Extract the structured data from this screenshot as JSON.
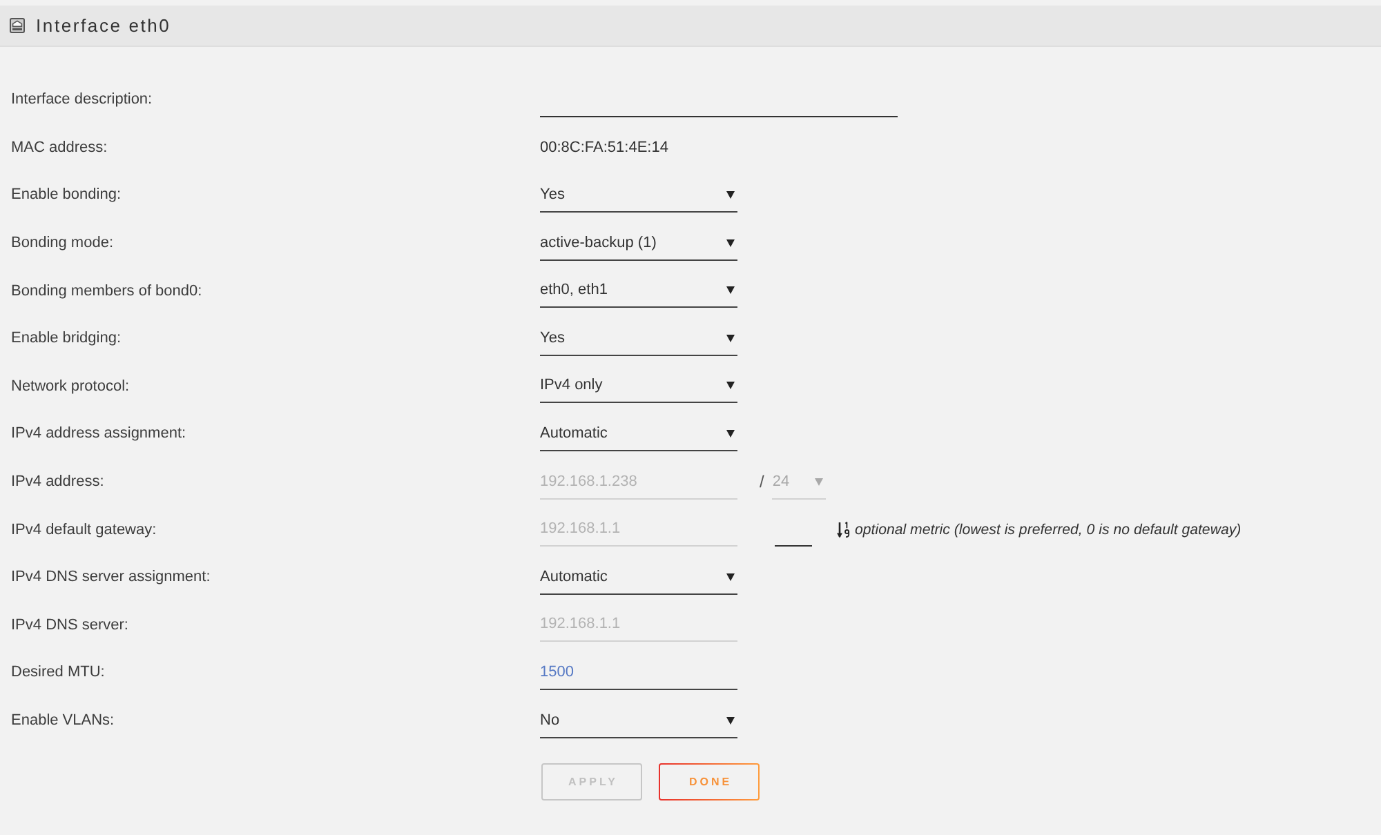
{
  "header": {
    "title": "Interface eth0"
  },
  "rows": [
    {
      "kind": "wide_input",
      "label": "Interface description:"
    },
    {
      "kind": "readout",
      "label": "MAC address:",
      "value": "00:8C:FA:51:4E:14"
    },
    {
      "kind": "select",
      "label": "Enable bonding:",
      "value": "Yes",
      "disabled": false
    },
    {
      "kind": "select",
      "label": "Bonding mode:",
      "value": "active-backup (1)",
      "disabled": false
    },
    {
      "kind": "select",
      "label": "Bonding members of bond0:",
      "value": "eth0, eth1",
      "disabled": false
    },
    {
      "kind": "select",
      "label": "Enable bridging:",
      "value": "Yes",
      "disabled": false
    },
    {
      "kind": "select",
      "label": "Network protocol:",
      "value": "IPv4 only",
      "disabled": false
    },
    {
      "kind": "select",
      "label": "IPv4 address assignment:",
      "value": "Automatic",
      "disabled": false
    },
    {
      "kind": "address",
      "label": "IPv4 address:",
      "value": "192.168.1.238",
      "disabled": true,
      "separator": "/",
      "prefix": {
        "value": "24",
        "disabled": true
      }
    },
    {
      "kind": "gateway",
      "label": "IPv4 default gateway:",
      "value": "192.168.1.1",
      "disabled": true,
      "metric_hint": "optional metric (lowest is preferred, 0 is no default gateway)"
    },
    {
      "kind": "select",
      "label": "IPv4 DNS server assignment:",
      "value": "Automatic",
      "disabled": false
    },
    {
      "kind": "input",
      "label": "IPv4 DNS server:",
      "value": "192.168.1.1",
      "disabled": true
    },
    {
      "kind": "input",
      "label": "Desired MTU:",
      "value": "1500",
      "disabled": false
    },
    {
      "kind": "select",
      "label": "Enable VLANs:",
      "value": "No",
      "disabled": false
    }
  ],
  "buttons": [
    {
      "label": "APPLY",
      "kind": "secondary",
      "disabled": true
    },
    {
      "label": "DONE",
      "kind": "primary",
      "disabled": false
    }
  ]
}
